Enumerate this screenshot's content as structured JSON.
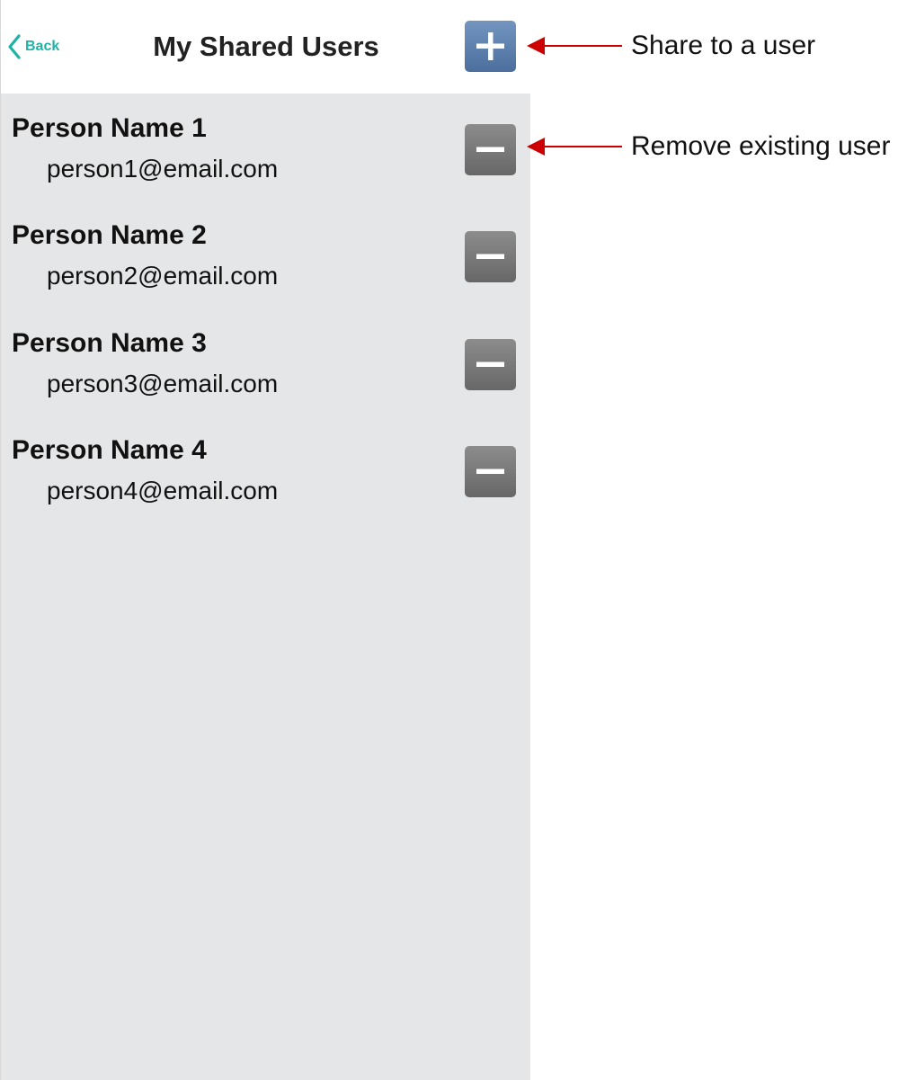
{
  "nav": {
    "back_label": "Back",
    "title": "My Shared Users",
    "add_button_icon": "plus-icon",
    "back_icon": "chevron-left-icon"
  },
  "users": [
    {
      "name": "Person Name 1",
      "email": "person1@email.com"
    },
    {
      "name": "Person Name 2",
      "email": "person2@email.com"
    },
    {
      "name": "Person Name 3",
      "email": "person3@email.com"
    },
    {
      "name": "Person Name 4",
      "email": "person4@email.com"
    }
  ],
  "annotations": {
    "share": "Share to a user",
    "remove": "Remove existing user"
  },
  "colors": {
    "accent": "#1fb3a5",
    "add_button": "#5b7fb0",
    "remove_button": "#7a7a7a",
    "list_background": "#e5e6e8",
    "annotation_arrow": "#cc0000"
  }
}
